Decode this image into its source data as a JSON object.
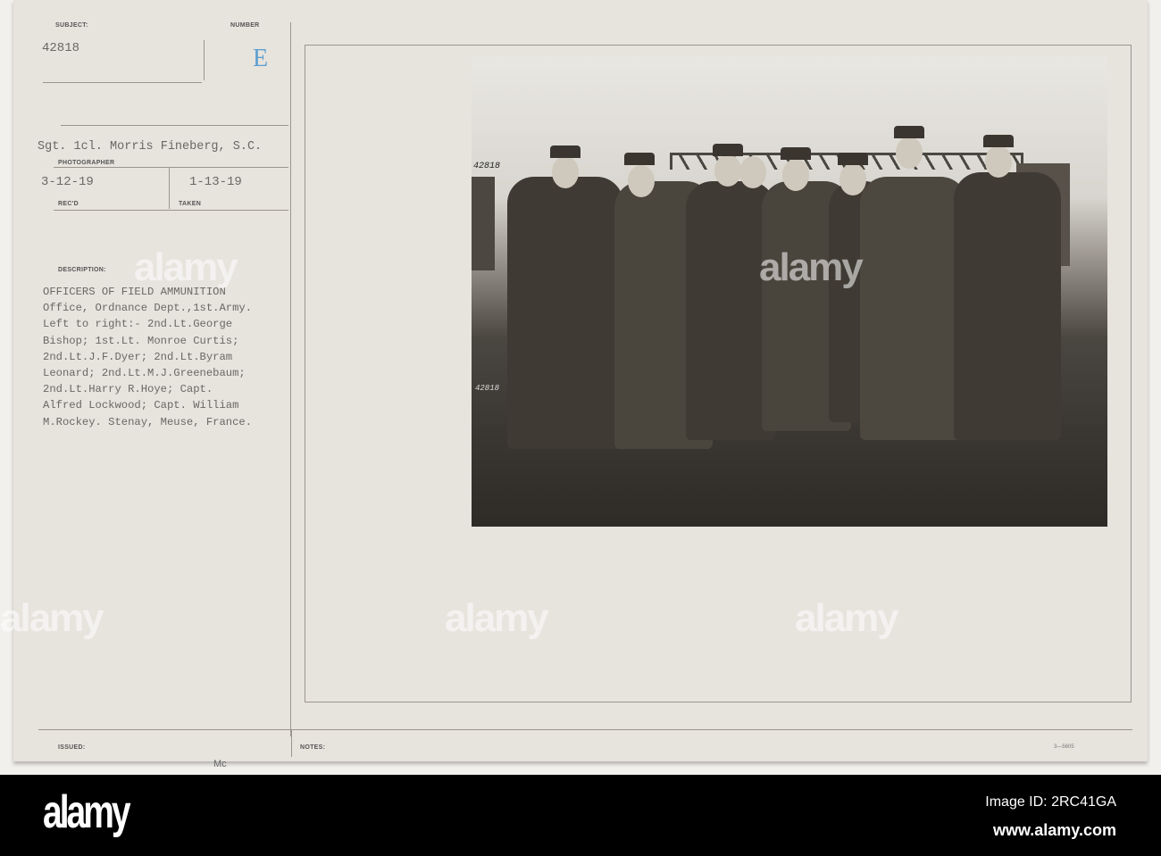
{
  "card": {
    "subject_label": "SUBJECT:",
    "subject_value": "42818",
    "number_label": "NUMBER",
    "number_value": "E",
    "photographer_value": "Sgt. 1cl. Morris Fineberg, S.C.",
    "photographer_label": "PHOTOGRAPHER",
    "received_value": "3-12-19",
    "received_label": "REC'D",
    "taken_value": "1-13-19",
    "taken_label": "TAKEN",
    "description_label": "DESCRIPTION:",
    "description_lines": [
      "OFFICERS OF FIELD AMMUNITION",
      "Office, Ordnance Dept.,1st.Army.",
      "Left to right:- 2nd.Lt.George",
      "Bishop; 1st.Lt. Monroe Curtis;",
      "2nd.Lt.J.F.Dyer; 2nd.Lt.Byram",
      "Leonard; 2nd.Lt.M.J.Greenebaum;",
      "2nd.Lt.Harry R.Hoye; Capt.",
      "Alfred Lockwood; Capt. William",
      "M.Rockey. Stenay, Meuse, France."
    ],
    "issued_label": "ISSUED:",
    "issued_value": "Mc",
    "notes_label": "NOTES:",
    "form_code": "3—5605"
  },
  "photo": {
    "negative_number_top": "42818",
    "negative_number_side": "42818"
  },
  "watermark": {
    "text": "alamy",
    "image_id": "Image ID: 2RC41GA",
    "url": "www.alamy.com"
  },
  "colors": {
    "card": "#e7e3dd",
    "number_stamp": "#5b9fd0",
    "footer": "#000000"
  }
}
